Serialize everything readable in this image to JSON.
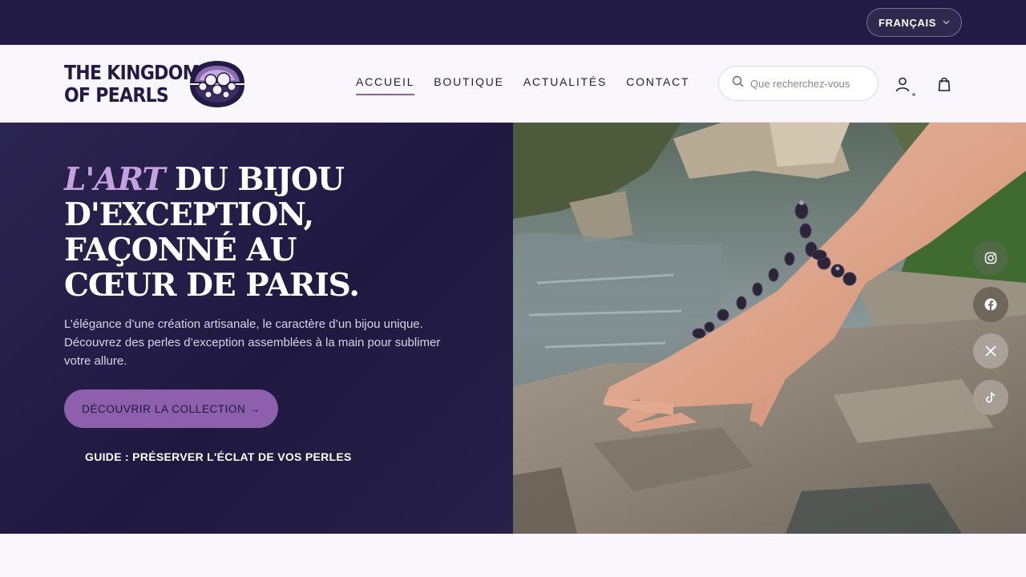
{
  "topbar": {
    "language": "FRANÇAIS"
  },
  "header": {
    "logo_line1": "THE KINGDOM",
    "logo_line2": "OF PEARLS",
    "nav": [
      {
        "label": "ACCUEIL",
        "active": true
      },
      {
        "label": "BOUTIQUE"
      },
      {
        "label": "ACTUALITÉS"
      },
      {
        "label": "CONTACT"
      }
    ],
    "search_placeholder": "Que recherchez-vous ?"
  },
  "hero": {
    "title_accent": "L'ART",
    "title_rest": " DU BIJOU D'EXCEPTION, FAÇONNÉ AU CŒUR DE PARIS.",
    "description": "L’élégance d’une création artisanale, le caractère d’un bijou unique. Découvrez des perles d’exception assemblées à la main pour sublimer votre allure.",
    "cta_label": "DÉCOUVRIR LA COLLECTION →",
    "guide_label": "GUIDE : PRÉSERVER L'ÉCLAT DE VOS PERLES"
  },
  "social": [
    "instagram-icon",
    "facebook-icon",
    "x-icon",
    "tiktok-icon"
  ],
  "colors": {
    "dark": "#221b45",
    "accent": "#8e5fad",
    "lavender": "#c6a1e0",
    "background": "#faf7fc"
  }
}
